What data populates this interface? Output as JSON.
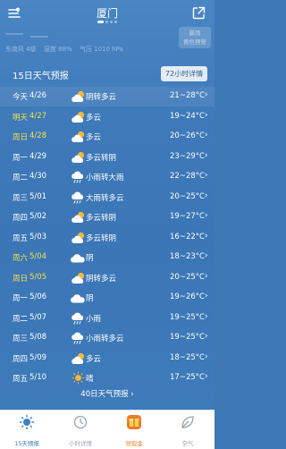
{
  "header": {
    "city": "厦门",
    "menu_icon": "menu-location-icon",
    "share_icon": "share-icon"
  },
  "summary": {
    "wind": "东南风 4级",
    "humidity": "湿度 88%",
    "pressure": "气压 1010 hPa"
  },
  "alert": {
    "line1": "暴雨",
    "line2": "黄色预警"
  },
  "forecast": {
    "title": "15日天气预报",
    "hourly_button": "72小时详情",
    "more_link": "40日天气预报 ›",
    "days": [
      {
        "day": "今天",
        "date": "4/26",
        "icon": "cloudy-sun-icon",
        "condition": "阴转多云",
        "temp": "21~28°C",
        "weekend": false
      },
      {
        "day": "明天",
        "date": "4/27",
        "icon": "cloudy-sun-icon",
        "condition": "多云",
        "temp": "19~24°C",
        "weekend": true
      },
      {
        "day": "周日",
        "date": "4/28",
        "icon": "cloudy-sun-icon",
        "condition": "多云",
        "temp": "20~26°C",
        "weekend": true
      },
      {
        "day": "周一",
        "date": "4/29",
        "icon": "cloudy-sun-icon",
        "condition": "多云转阴",
        "temp": "23~29°C",
        "weekend": false
      },
      {
        "day": "周二",
        "date": "4/30",
        "icon": "rain-icon",
        "condition": "小雨转大雨",
        "temp": "22~28°C",
        "weekend": false
      },
      {
        "day": "周三",
        "date": "5/01",
        "icon": "rain-icon",
        "condition": "大雨转多云",
        "temp": "20~25°C",
        "weekend": false
      },
      {
        "day": "周四",
        "date": "5/02",
        "icon": "cloudy-sun-icon",
        "condition": "多云转阴",
        "temp": "19~27°C",
        "weekend": false
      },
      {
        "day": "周五",
        "date": "5/03",
        "icon": "cloudy-sun-icon",
        "condition": "多云转阴",
        "temp": "16~22°C",
        "weekend": false
      },
      {
        "day": "周六",
        "date": "5/04",
        "icon": "overcast-icon",
        "condition": "阴",
        "temp": "18~23°C",
        "weekend": true
      },
      {
        "day": "周日",
        "date": "5/05",
        "icon": "cloudy-sun-icon",
        "condition": "阴转多云",
        "temp": "20~25°C",
        "weekend": true
      },
      {
        "day": "周一",
        "date": "5/06",
        "icon": "overcast-icon",
        "condition": "阴",
        "temp": "19~26°C",
        "weekend": false
      },
      {
        "day": "周二",
        "date": "5/07",
        "icon": "rain-icon",
        "condition": "小雨",
        "temp": "19~25°C",
        "weekend": false
      },
      {
        "day": "周三",
        "date": "5/08",
        "icon": "rain-icon",
        "condition": "小雨转多云",
        "temp": "19~25°C",
        "weekend": false
      },
      {
        "day": "周四",
        "date": "5/09",
        "icon": "cloudy-sun-icon",
        "condition": "多云",
        "temp": "18~25°C",
        "weekend": false
      },
      {
        "day": "周五",
        "date": "5/10",
        "icon": "sunny-icon",
        "condition": "晴",
        "temp": "17~25°C",
        "weekend": false
      }
    ]
  },
  "tabs": [
    {
      "label": "15天预报",
      "icon": "sun-icon",
      "active": true
    },
    {
      "label": "小时详情",
      "icon": "clock-icon",
      "active": false
    },
    {
      "label": "领现金",
      "icon": "gift-icon",
      "active": false
    },
    {
      "label": "空气",
      "icon": "leaf-icon",
      "active": false
    }
  ],
  "colors": {
    "background": "#3e78b5",
    "weekend_text": "#f5e04a",
    "tab_active": "#3f80c2",
    "tab_gift": "#f0792c",
    "sun": "#f6b93a"
  }
}
